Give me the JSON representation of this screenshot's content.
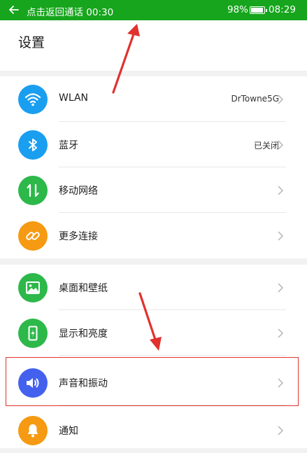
{
  "statusbar": {
    "call_text": "点击返回通话 00:30",
    "battery_percent": "98%",
    "battery_level": 0.98,
    "time": "08:29"
  },
  "header": {
    "title": "设置"
  },
  "groups": [
    {
      "items": [
        {
          "label": "WLAN",
          "value": "DrTowne5G",
          "icon": "wifi-icon",
          "color": "#1a9ef0"
        },
        {
          "label": "蓝牙",
          "value": "已关闭",
          "icon": "bluetooth-icon",
          "color": "#1a9ef0"
        },
        {
          "label": "移动网络",
          "value": "",
          "icon": "mobile-network-icon",
          "color": "#2db84a"
        },
        {
          "label": "更多连接",
          "value": "",
          "icon": "link-icon",
          "color": "#f59a12"
        }
      ]
    },
    {
      "items": [
        {
          "label": "桌面和壁纸",
          "value": "",
          "icon": "wallpaper-icon",
          "color": "#2db84a"
        },
        {
          "label": "显示和亮度",
          "value": "",
          "icon": "display-brightness-icon",
          "color": "#2db84a"
        },
        {
          "label": "声音和振动",
          "value": "",
          "icon": "sound-icon",
          "color": "#4361ee"
        },
        {
          "label": "通知",
          "value": "",
          "icon": "bell-icon",
          "color": "#f59a12"
        }
      ]
    }
  ],
  "colors": {
    "statusbar": "#16a51c",
    "annotation": "#e0322e"
  }
}
